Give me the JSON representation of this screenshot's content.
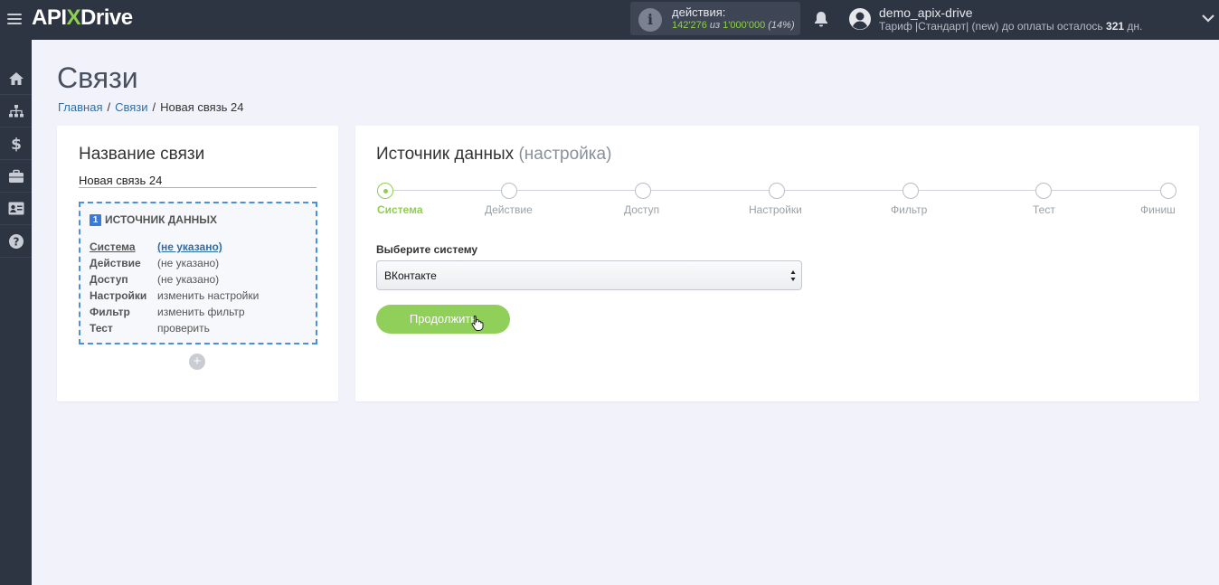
{
  "header": {
    "logo_api": "API",
    "logo_x": "X",
    "logo_drive": "Drive",
    "actions_label": "действия:",
    "actions_used": "142'276",
    "actions_of": "из",
    "actions_total": "1'000'000",
    "actions_percent": "(14%)",
    "user_name": "demo_apix-drive",
    "plan_prefix": "Тариф |Стандарт| (new) до оплаты осталось",
    "plan_days": "321",
    "plan_suffix": "дн."
  },
  "sidebar": {
    "items": [
      "home-icon",
      "sitemap-icon",
      "dollar-icon",
      "briefcase-icon",
      "id-card-icon",
      "help-icon"
    ]
  },
  "page": {
    "title": "Связи",
    "breadcrumb": [
      "Главная",
      "Связи",
      "Новая связь 24"
    ]
  },
  "left_card": {
    "title": "Название связи",
    "name_value": "Новая связь 24",
    "source_number": "1",
    "source_title": "ИСТОЧНИК ДАННЫХ",
    "rows": [
      {
        "key": "Система",
        "value": "(не указано)"
      },
      {
        "key": "Действие",
        "value": "(не указано)"
      },
      {
        "key": "Доступ",
        "value": "(не указано)"
      },
      {
        "key": "Настройки",
        "value": "изменить настройки"
      },
      {
        "key": "Фильтр",
        "value": "изменить фильтр"
      },
      {
        "key": "Тест",
        "value": "проверить"
      }
    ],
    "add_label": "+"
  },
  "right_card": {
    "title": "Источник данных",
    "title_sub": "(настройка)",
    "steps": [
      "Система",
      "Действие",
      "Доступ",
      "Настройки",
      "Фильтр",
      "Тест",
      "Финиш"
    ],
    "active_step": 0,
    "select_label": "Выберите систему",
    "select_value": "ВКонтакте",
    "continue_label": "Продолжить"
  },
  "colors": {
    "accent_green": "#8fcf4f",
    "header_bg": "#2d3442",
    "link_blue": "#2f6fa8",
    "dashed_border": "#4a8fe0"
  }
}
